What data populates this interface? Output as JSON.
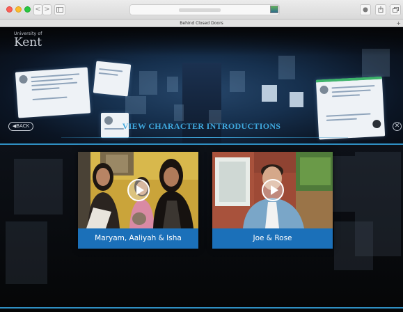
{
  "browser": {
    "tab_title": "Behind Closed Doors",
    "new_tab": "+",
    "back": "<",
    "forward": ">",
    "reload": "↻"
  },
  "site": {
    "logo_small": "University of",
    "logo_big": "Kent"
  },
  "overlay": {
    "back_label": "BACK",
    "back_arrow": "◀",
    "close_label": "✕",
    "title": "VIEW CHARACTER INTRODUCTIONS"
  },
  "cards": [
    {
      "label": "Maryam, Aaliyah & Isha"
    },
    {
      "label": "Joe & Rose"
    }
  ],
  "colors": {
    "accent": "#3fa8de",
    "card_bg": "#1b70b9",
    "divider": "#2f8fc2"
  }
}
